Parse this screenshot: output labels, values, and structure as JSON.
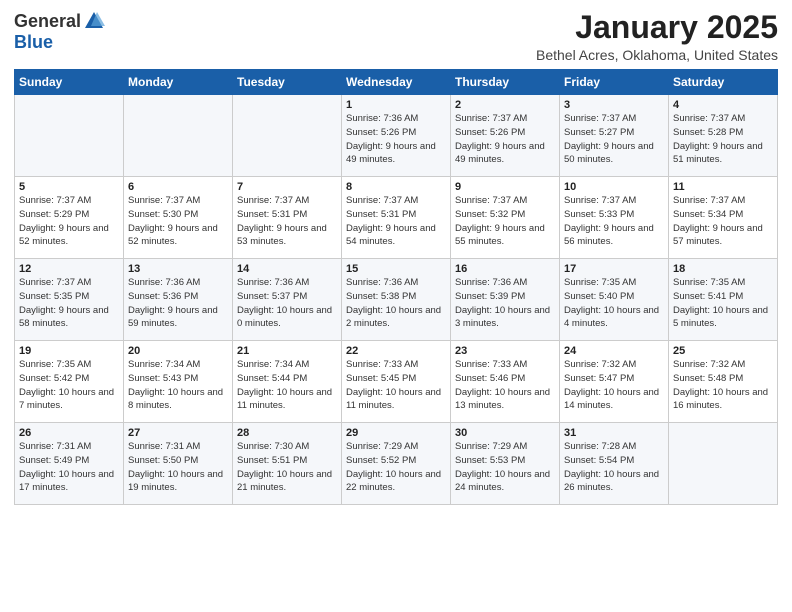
{
  "header": {
    "logo_general": "General",
    "logo_blue": "Blue",
    "month": "January 2025",
    "location": "Bethel Acres, Oklahoma, United States"
  },
  "weekdays": [
    "Sunday",
    "Monday",
    "Tuesday",
    "Wednesday",
    "Thursday",
    "Friday",
    "Saturday"
  ],
  "weeks": [
    [
      {
        "day": "",
        "info": ""
      },
      {
        "day": "",
        "info": ""
      },
      {
        "day": "",
        "info": ""
      },
      {
        "day": "1",
        "info": "Sunrise: 7:36 AM\nSunset: 5:26 PM\nDaylight: 9 hours\nand 49 minutes."
      },
      {
        "day": "2",
        "info": "Sunrise: 7:37 AM\nSunset: 5:26 PM\nDaylight: 9 hours\nand 49 minutes."
      },
      {
        "day": "3",
        "info": "Sunrise: 7:37 AM\nSunset: 5:27 PM\nDaylight: 9 hours\nand 50 minutes."
      },
      {
        "day": "4",
        "info": "Sunrise: 7:37 AM\nSunset: 5:28 PM\nDaylight: 9 hours\nand 51 minutes."
      }
    ],
    [
      {
        "day": "5",
        "info": "Sunrise: 7:37 AM\nSunset: 5:29 PM\nDaylight: 9 hours\nand 52 minutes."
      },
      {
        "day": "6",
        "info": "Sunrise: 7:37 AM\nSunset: 5:30 PM\nDaylight: 9 hours\nand 52 minutes."
      },
      {
        "day": "7",
        "info": "Sunrise: 7:37 AM\nSunset: 5:31 PM\nDaylight: 9 hours\nand 53 minutes."
      },
      {
        "day": "8",
        "info": "Sunrise: 7:37 AM\nSunset: 5:31 PM\nDaylight: 9 hours\nand 54 minutes."
      },
      {
        "day": "9",
        "info": "Sunrise: 7:37 AM\nSunset: 5:32 PM\nDaylight: 9 hours\nand 55 minutes."
      },
      {
        "day": "10",
        "info": "Sunrise: 7:37 AM\nSunset: 5:33 PM\nDaylight: 9 hours\nand 56 minutes."
      },
      {
        "day": "11",
        "info": "Sunrise: 7:37 AM\nSunset: 5:34 PM\nDaylight: 9 hours\nand 57 minutes."
      }
    ],
    [
      {
        "day": "12",
        "info": "Sunrise: 7:37 AM\nSunset: 5:35 PM\nDaylight: 9 hours\nand 58 minutes."
      },
      {
        "day": "13",
        "info": "Sunrise: 7:36 AM\nSunset: 5:36 PM\nDaylight: 9 hours\nand 59 minutes."
      },
      {
        "day": "14",
        "info": "Sunrise: 7:36 AM\nSunset: 5:37 PM\nDaylight: 10 hours\nand 0 minutes."
      },
      {
        "day": "15",
        "info": "Sunrise: 7:36 AM\nSunset: 5:38 PM\nDaylight: 10 hours\nand 2 minutes."
      },
      {
        "day": "16",
        "info": "Sunrise: 7:36 AM\nSunset: 5:39 PM\nDaylight: 10 hours\nand 3 minutes."
      },
      {
        "day": "17",
        "info": "Sunrise: 7:35 AM\nSunset: 5:40 PM\nDaylight: 10 hours\nand 4 minutes."
      },
      {
        "day": "18",
        "info": "Sunrise: 7:35 AM\nSunset: 5:41 PM\nDaylight: 10 hours\nand 5 minutes."
      }
    ],
    [
      {
        "day": "19",
        "info": "Sunrise: 7:35 AM\nSunset: 5:42 PM\nDaylight: 10 hours\nand 7 minutes."
      },
      {
        "day": "20",
        "info": "Sunrise: 7:34 AM\nSunset: 5:43 PM\nDaylight: 10 hours\nand 8 minutes."
      },
      {
        "day": "21",
        "info": "Sunrise: 7:34 AM\nSunset: 5:44 PM\nDaylight: 10 hours\nand 11 minutes."
      },
      {
        "day": "22",
        "info": "Sunrise: 7:33 AM\nSunset: 5:45 PM\nDaylight: 10 hours\nand 11 minutes."
      },
      {
        "day": "23",
        "info": "Sunrise: 7:33 AM\nSunset: 5:46 PM\nDaylight: 10 hours\nand 13 minutes."
      },
      {
        "day": "24",
        "info": "Sunrise: 7:32 AM\nSunset: 5:47 PM\nDaylight: 10 hours\nand 14 minutes."
      },
      {
        "day": "25",
        "info": "Sunrise: 7:32 AM\nSunset: 5:48 PM\nDaylight: 10 hours\nand 16 minutes."
      }
    ],
    [
      {
        "day": "26",
        "info": "Sunrise: 7:31 AM\nSunset: 5:49 PM\nDaylight: 10 hours\nand 17 minutes."
      },
      {
        "day": "27",
        "info": "Sunrise: 7:31 AM\nSunset: 5:50 PM\nDaylight: 10 hours\nand 19 minutes."
      },
      {
        "day": "28",
        "info": "Sunrise: 7:30 AM\nSunset: 5:51 PM\nDaylight: 10 hours\nand 21 minutes."
      },
      {
        "day": "29",
        "info": "Sunrise: 7:29 AM\nSunset: 5:52 PM\nDaylight: 10 hours\nand 22 minutes."
      },
      {
        "day": "30",
        "info": "Sunrise: 7:29 AM\nSunset: 5:53 PM\nDaylight: 10 hours\nand 24 minutes."
      },
      {
        "day": "31",
        "info": "Sunrise: 7:28 AM\nSunset: 5:54 PM\nDaylight: 10 hours\nand 26 minutes."
      },
      {
        "day": "",
        "info": ""
      }
    ]
  ]
}
